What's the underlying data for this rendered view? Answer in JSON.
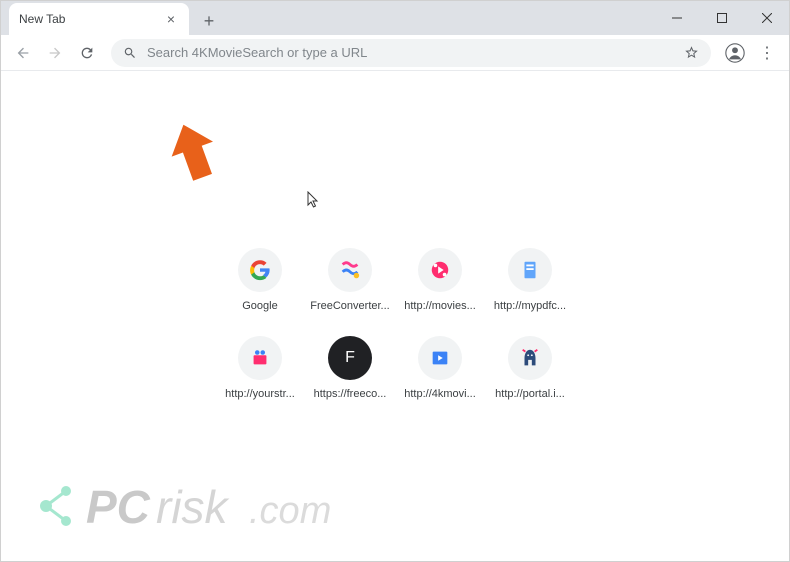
{
  "tab": {
    "title": "New Tab"
  },
  "omnibox": {
    "placeholder": "Search 4KMovieSearch or type a URL"
  },
  "shortcuts": [
    {
      "label": "Google",
      "icon": "google"
    },
    {
      "label": "FreeConverter...",
      "icon": "freeconverter"
    },
    {
      "label": "http://movies...",
      "icon": "movies"
    },
    {
      "label": "http://mypdfc...",
      "icon": "mypdf"
    },
    {
      "label": "http://yourstr...",
      "icon": "yourstr"
    },
    {
      "label": "https://freeco...",
      "icon": "f-dark"
    },
    {
      "label": "http://4kmovi...",
      "icon": "4kmov"
    },
    {
      "label": "http://portal.i...",
      "icon": "portal"
    }
  ],
  "watermark": {
    "text": "PCrisk.com"
  }
}
